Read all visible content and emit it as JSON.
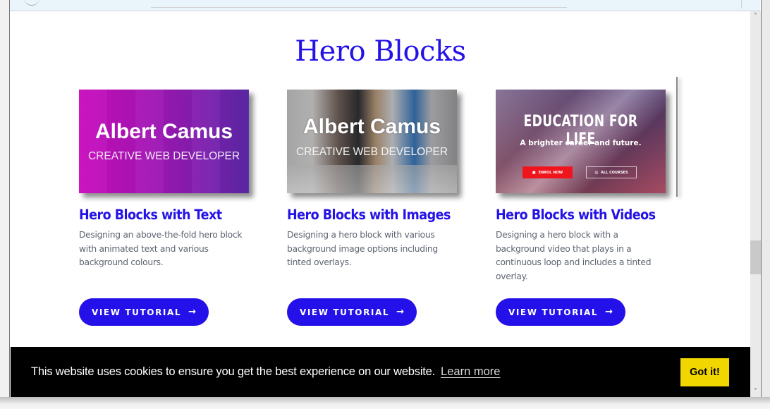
{
  "page": {
    "title": "Hero Blocks"
  },
  "cards": [
    {
      "thumb_type": "text",
      "thumb_name": "Albert Camus",
      "thumb_role": "CREATIVE WEB DEVELOPER",
      "title": "Hero Blocks with Text",
      "description": "Designing an above-the-fold hero block with animated text and various background colours.",
      "button_label": "VIEW TUTORIAL",
      "button_icon": "arrow-right-icon"
    },
    {
      "thumb_type": "images",
      "thumb_name": "Albert Camus",
      "thumb_role": "CREATIVE WEB DEVELOPER",
      "title": "Hero Blocks with Images",
      "description": "Designing a hero block with various background image options including tinted overlays.",
      "button_label": "VIEW TUTORIAL",
      "button_icon": "arrow-right-icon"
    },
    {
      "thumb_type": "videos",
      "thumb_title": "EDUCATION FOR LIFE",
      "thumb_subtitle": "A brighter career and future.",
      "thumb_buttons": [
        "ENROL NOW",
        "ALL COURSES"
      ],
      "title": "Hero Blocks with Videos",
      "description": "Designing a hero block with a background video that plays in a continuous loop and includes a tinted overlay.",
      "button_label": "VIEW TUTORIAL",
      "button_icon": "arrow-right-icon"
    }
  ],
  "cookie_banner": {
    "message": "This website uses cookies to ensure you get the best experience on our website.",
    "link_label": "Learn more",
    "button_label": "Got it!"
  },
  "scrollbar": {
    "position_fraction": 0.66
  },
  "colors": {
    "accent": "#2410e8",
    "cookie_button": "#f1d600",
    "cookie_background": "#000000",
    "description_text": "#5d6470"
  },
  "icons": {
    "arrow": "→",
    "scroll_up": "˄",
    "scroll_down": "˅",
    "graduation": "■",
    "courses": "▤"
  }
}
